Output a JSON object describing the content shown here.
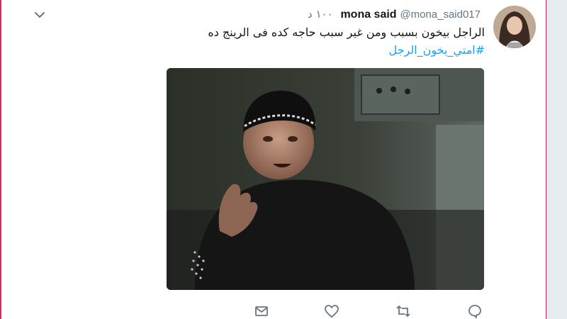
{
  "tweet": {
    "display_name": "mona said",
    "handle": "@mona_said017",
    "timestamp": "١٠٠ د",
    "text": "الراجل بيخون بسبب ومن غير سبب حاجه كده فى الرينج ده",
    "hashtag": "#امتي_يخون_الرجل"
  },
  "actions": {
    "icons": [
      "reply-icon",
      "retweet-icon",
      "like-icon",
      "message-icon"
    ]
  },
  "colors": {
    "accent": "#1da1f2",
    "text": "#14171a",
    "muted": "#657786",
    "frame_edge": "#e0245e"
  }
}
